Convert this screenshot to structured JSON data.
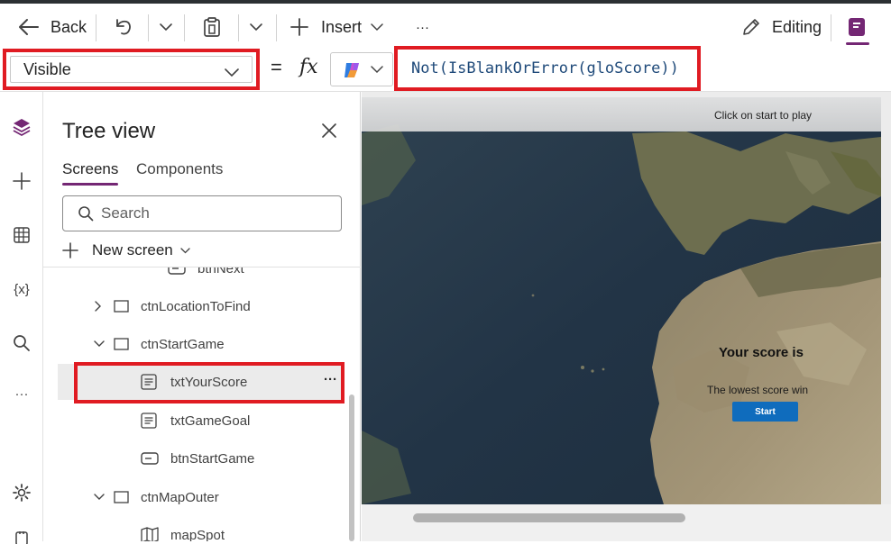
{
  "toolbar": {
    "back_label": "Back",
    "insert_label": "Insert",
    "more_label": "···",
    "editing_label": "Editing"
  },
  "formula_bar": {
    "property": "Visible",
    "equals": "=",
    "fx": "fx",
    "formula": "Not(IsBlankOrError(gloScore))"
  },
  "rail": {
    "variables_label": "{x}",
    "more_label": "···"
  },
  "tree": {
    "title": "Tree view",
    "tabs": [
      "Screens",
      "Components"
    ],
    "search_placeholder": "Search",
    "new_screen_label": "New screen",
    "nodes": [
      {
        "label": "btnNext",
        "kind": "button"
      },
      {
        "label": "ctnLocationToFind",
        "kind": "container",
        "expanded": false
      },
      {
        "label": "ctnStartGame",
        "kind": "container",
        "expanded": true
      },
      {
        "label": "txtYourScore",
        "kind": "text",
        "selected": true
      },
      {
        "label": "txtGameGoal",
        "kind": "text"
      },
      {
        "label": "btnStartGame",
        "kind": "button"
      },
      {
        "label": "ctnMapOuter",
        "kind": "container",
        "expanded": true
      },
      {
        "label": "mapSpot",
        "kind": "map"
      }
    ],
    "row_more": "···"
  },
  "canvas": {
    "hint": "Click on start to play",
    "score_title": "Your score is",
    "score_goal": "The lowest score win",
    "start_button": "Start"
  },
  "colors": {
    "accent": "#742774",
    "highlight": "#e01b22",
    "start_button": "#0f6cbd",
    "formula_text": "#1f4a7a"
  }
}
